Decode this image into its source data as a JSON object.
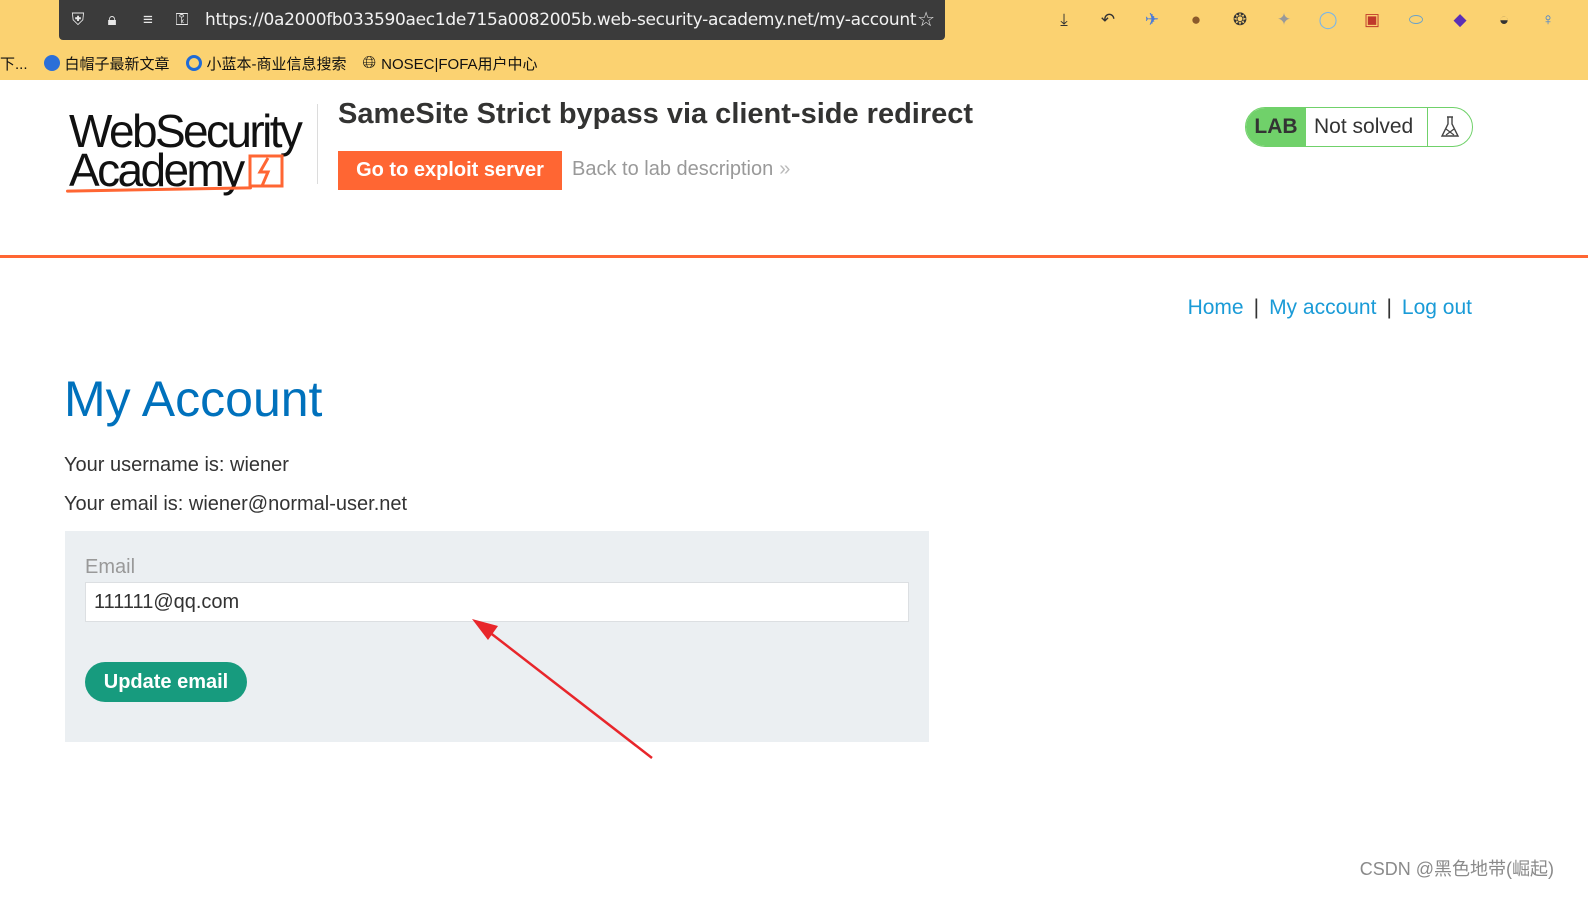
{
  "browser": {
    "url": "https://0a2000fb033590aec1de715a0082005b.web-security-academy.net/my-account",
    "bookmarks": [
      {
        "label": "下...",
        "icon": "truncated-bookmark-icon"
      },
      {
        "label": "白帽子最新文章",
        "icon": "bookmark-favicon-icon"
      },
      {
        "label": "小蓝本-商业信息搜索",
        "icon": "search-favicon-icon"
      },
      {
        "label": "NOSEC|FOFA用户中心",
        "icon": "globe-icon"
      }
    ]
  },
  "logo": {
    "line1": "WebSecurity",
    "line2": "Academy"
  },
  "lab": {
    "title": "SameSite Strict bypass via client-side redirect",
    "exploit_button": "Go to exploit server",
    "back_link": "Back to lab description",
    "back_chevron": "»",
    "badge": "LAB",
    "status": "Not solved"
  },
  "nav": {
    "home": "Home",
    "separator": "|",
    "my_account": "My account",
    "logout": "Log out"
  },
  "account": {
    "title": "My Account",
    "username_line": "Your username is: wiener",
    "email_line": "Your email is: wiener@normal-user.net",
    "email_label": "Email",
    "email_value": "111111@qq.com",
    "update_button": "Update email"
  },
  "watermark": "CSDN @黑色地带(崛起)",
  "colors": {
    "browser_bar": "#fbd271",
    "accent_orange": "#ff6633",
    "title_blue": "#0071bc",
    "link_blue": "#1a9bd7",
    "lab_green": "#70d16a",
    "button_teal": "#179b7e",
    "panel_gray": "#ebeff2",
    "annotation_red": "#e8262b"
  }
}
